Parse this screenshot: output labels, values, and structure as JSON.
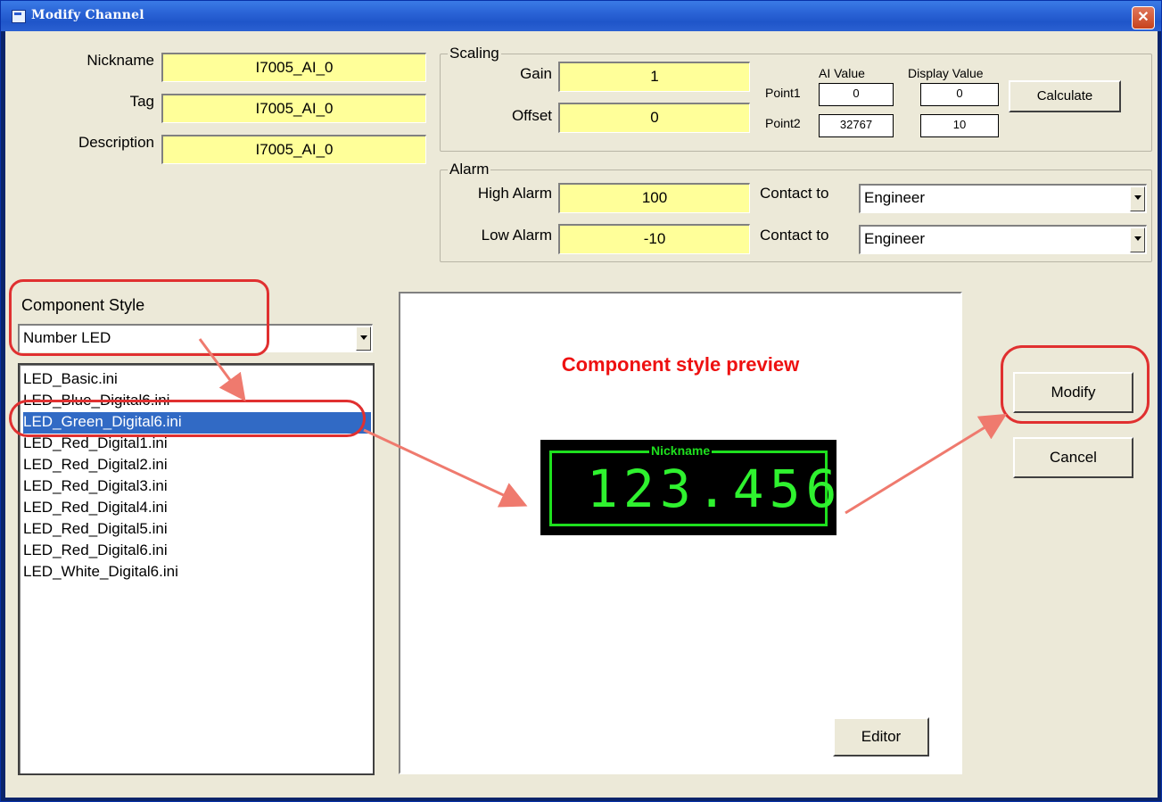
{
  "window": {
    "title": "Modify Channel",
    "close_glyph": "✕"
  },
  "identity": {
    "nickname_label": "Nickname",
    "nickname_value": "I7005_AI_0",
    "tag_label": "Tag",
    "tag_value": "I7005_AI_0",
    "description_label": "Description",
    "description_value": "I7005_AI_0"
  },
  "scaling": {
    "title": "Scaling",
    "gain_label": "Gain",
    "gain_value": "1",
    "offset_label": "Offset",
    "offset_value": "0",
    "ai_value_header": "AI Value",
    "display_value_header": "Display Value",
    "point1_label": "Point1",
    "point1_ai": "0",
    "point1_display": "0",
    "point2_label": "Point2",
    "point2_ai": "32767",
    "point2_display": "10",
    "calculate_label": "Calculate"
  },
  "alarm": {
    "title": "Alarm",
    "high_label": "High Alarm",
    "high_value": "100",
    "low_label": "Low Alarm",
    "low_value": "-10",
    "contact_label_1": "Contact to",
    "contact_value_1": "Engineer",
    "contact_label_2": "Contact to",
    "contact_value_2": "Engineer"
  },
  "component": {
    "label": "Component Style",
    "selected_style": "Number LED",
    "files": [
      "LED_Basic.ini",
      "LED_Blue_Digital6.ini",
      "LED_Green_Digital6.ini",
      "LED_Red_Digital1.ini",
      "LED_Red_Digital2.ini",
      "LED_Red_Digital3.ini",
      "LED_Red_Digital4.ini",
      "LED_Red_Digital5.ini",
      "LED_Red_Digital6.ini",
      "LED_White_Digital6.ini"
    ],
    "selected_index": 2
  },
  "preview": {
    "title": "Component style preview",
    "led_name": "Nickname",
    "led_value": "123.456",
    "editor_label": "Editor"
  },
  "actions": {
    "modify_label": "Modify",
    "cancel_label": "Cancel"
  },
  "colors": {
    "field_yellow": "#ffff99",
    "led_green": "#1ee01e",
    "highlight_red": "#e03030",
    "selection_blue": "#316ac5"
  }
}
